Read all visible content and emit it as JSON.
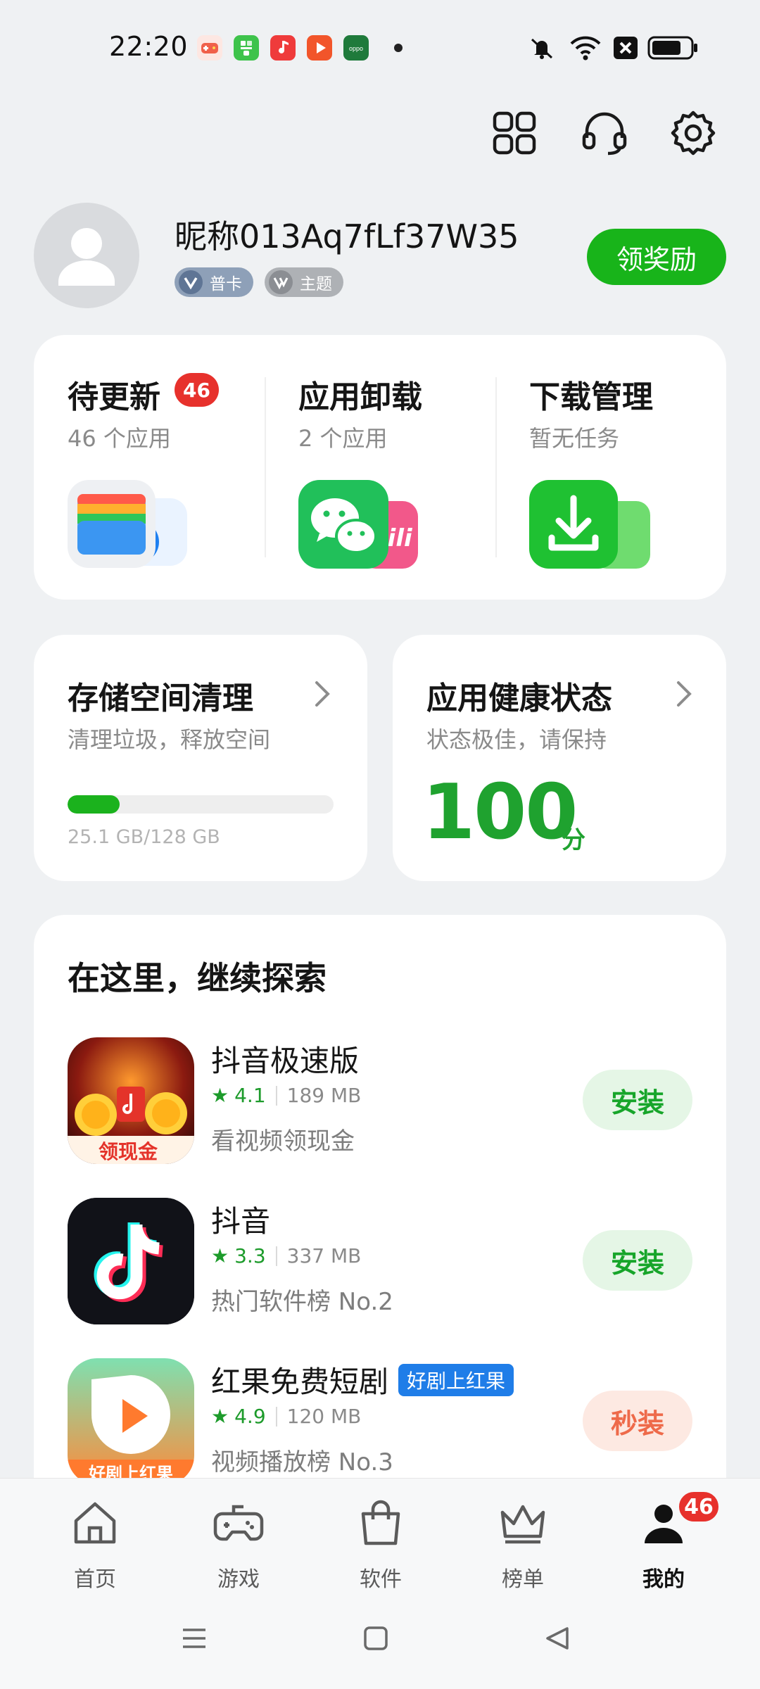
{
  "status_bar": {
    "time": "22:20",
    "notif_icons": [
      "game-app-icon",
      "grid-app-icon",
      "music-app-icon",
      "video-app-icon",
      "oppo-app-icon"
    ]
  },
  "top_actions": [
    "app-grid-icon",
    "headset-icon",
    "settings-gear-icon"
  ],
  "profile": {
    "nickname": "昵称013Aq7fLf37W35",
    "badges": [
      {
        "label": "普卡",
        "color": "#7f95b3"
      },
      {
        "label": "主题",
        "color": "#a3a6ab"
      }
    ],
    "reward_label": "领奖励"
  },
  "quick_actions": [
    {
      "title": "待更新",
      "badge": "46",
      "sub": "46 个应用"
    },
    {
      "title": "应用卸载",
      "sub": "2 个应用"
    },
    {
      "title": "下载管理",
      "sub": "暂无任务"
    }
  ],
  "storage": {
    "title": "存储空间清理",
    "sub": "清理垃圾，释放空间",
    "usage_text": "25.1 GB/128 GB",
    "used_fraction": 0.196
  },
  "health": {
    "title": "应用健康状态",
    "sub": "状态极佳，请保持",
    "score": "100",
    "unit": "分"
  },
  "explore": {
    "title": "在这里，继续探索",
    "apps": [
      {
        "name": "抖音极速版",
        "rating": "4.1",
        "size": "189 MB",
        "desc": "看视频领现金",
        "button": "安装",
        "icon_text": "领现金"
      },
      {
        "name": "抖音",
        "rating": "3.3",
        "size": "337 MB",
        "desc": "热门软件榜 No.2",
        "button": "安装"
      },
      {
        "name": "红果免费短剧",
        "tag": "好剧上红果",
        "rating": "4.9",
        "size": "120 MB",
        "desc": "视频播放榜 No.3",
        "button": "秒装",
        "icon_text": "好剧上红果"
      }
    ]
  },
  "bottom_nav": [
    {
      "label": "首页"
    },
    {
      "label": "游戏"
    },
    {
      "label": "软件"
    },
    {
      "label": "榜单"
    },
    {
      "label": "我的",
      "badge": "46",
      "active": true
    }
  ],
  "colors": {
    "accent_green": "#18b41a",
    "badge_red": "#e7312c",
    "health_green": "#1fa22f"
  }
}
